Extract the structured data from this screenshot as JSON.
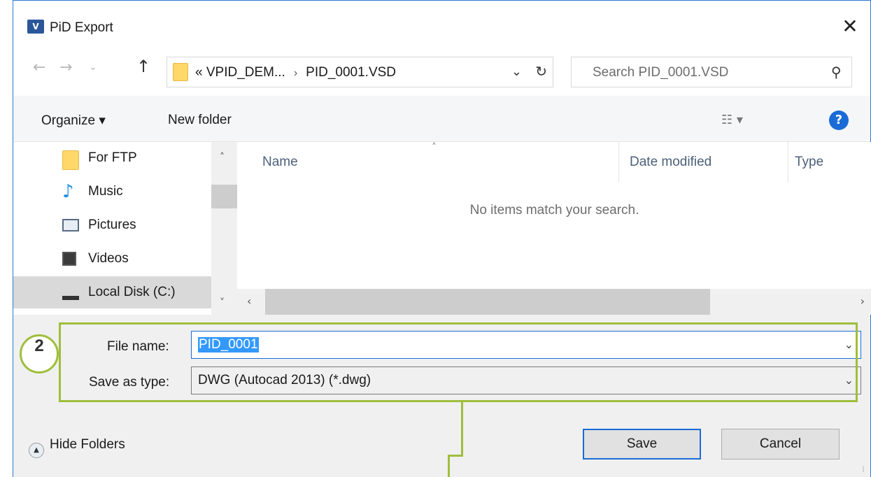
{
  "window": {
    "title": "PiD Export",
    "app_icon": "visio-icon",
    "close": "✕"
  },
  "nav": {
    "back": "←",
    "forward": "→",
    "recent": "⌄",
    "up": "↑",
    "path": [
      "« VPID_DEM...",
      "PID_0001.VSD"
    ],
    "path_sep": "›",
    "dropdown": "⌄",
    "refresh": "↻"
  },
  "search": {
    "placeholder": "Search PID_0001.VSD",
    "icon": "⚲"
  },
  "toolbar": {
    "organize": "Organize ▾",
    "new_folder": "New folder",
    "view": "☷ ▾",
    "help": "?"
  },
  "sidebar": {
    "items": [
      {
        "label": "For FTP",
        "icon": "folder-icon"
      },
      {
        "label": "Music",
        "icon": "music-icon"
      },
      {
        "label": "Pictures",
        "icon": "pictures-icon"
      },
      {
        "label": "Videos",
        "icon": "videos-icon"
      },
      {
        "label": "Local Disk (C:)",
        "icon": "disk-icon",
        "selected": true
      }
    ],
    "scroll_up": "˄",
    "scroll_down": "˅"
  },
  "filelist": {
    "columns": [
      "Name",
      "Date modified",
      "Type"
    ],
    "sort_caret": "˄",
    "empty_message": "No items match your search.",
    "scroll_left": "‹",
    "scroll_right": "›"
  },
  "form": {
    "file_name_label": "File name:",
    "file_name_value": "PID_0001",
    "save_as_label": "Save as type:",
    "save_as_value": "DWG (Autocad 2013) (*.dwg)",
    "dropdown": "⌄"
  },
  "annotation": {
    "step": "2",
    "color": "#a0be3c"
  },
  "footer": {
    "hide_folders": "Hide Folders",
    "hide_icon": "▲",
    "save": "Save",
    "cancel": "Cancel",
    "grip": "⁞"
  },
  "colors": {
    "accent": "#1a6bd6",
    "selection": "#3399ff",
    "folder": "#ffd869"
  }
}
